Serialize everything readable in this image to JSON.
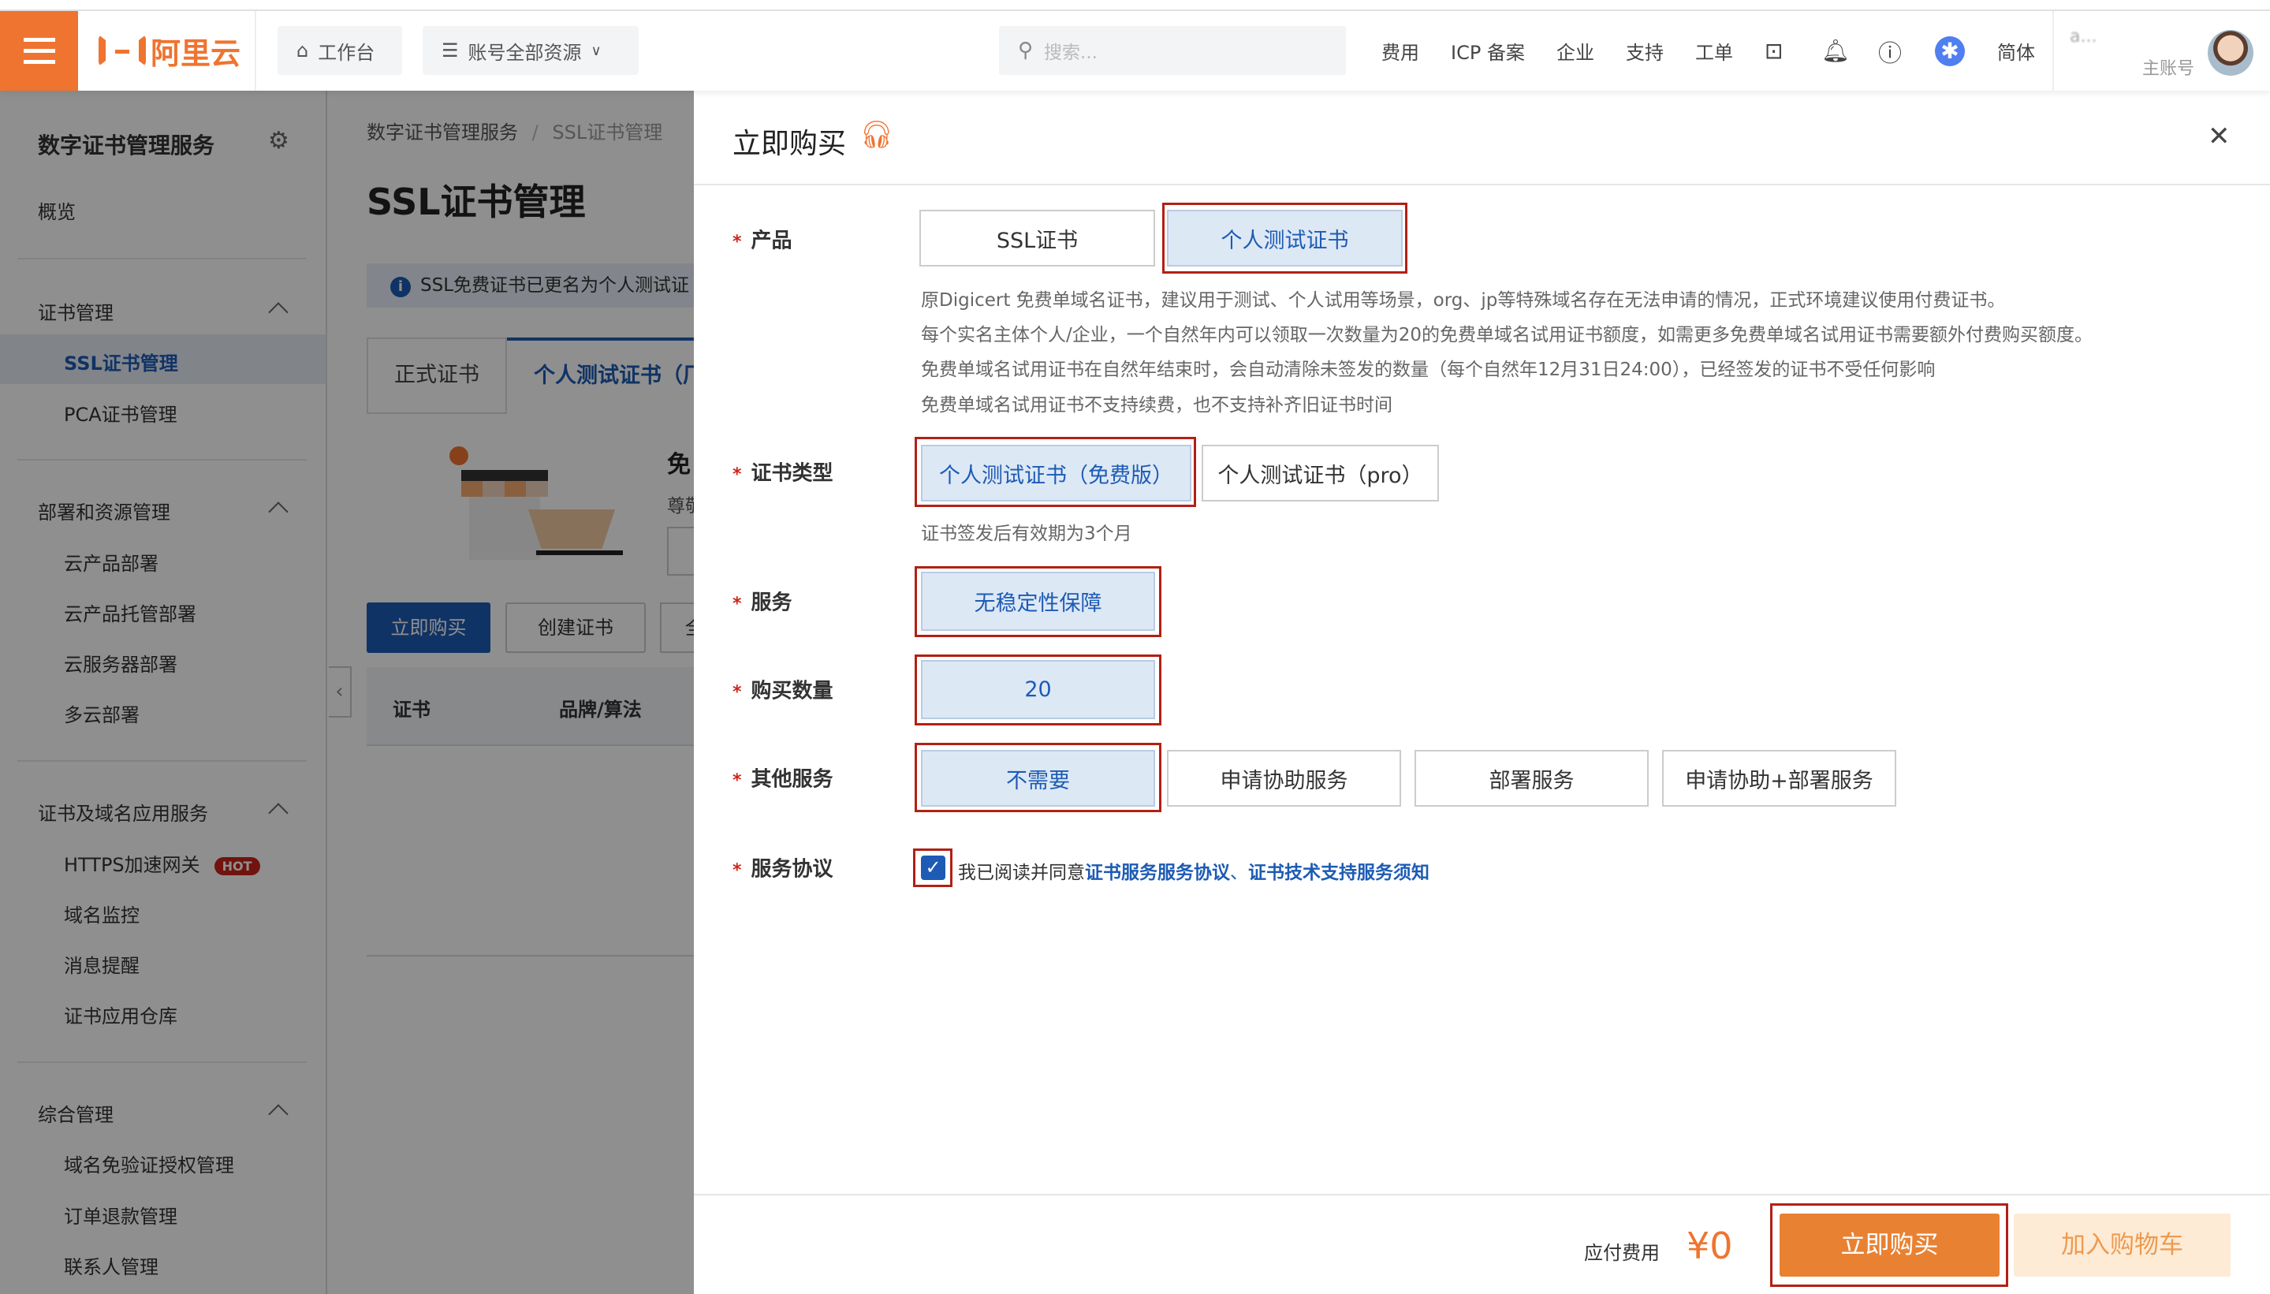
{
  "header": {
    "logo_text": "阿里云",
    "workbench": "工作台",
    "resources": "账号全部资源",
    "search_placeholder": "搜索...",
    "nav": [
      "费用",
      "ICP 备案",
      "企业",
      "支持",
      "工单"
    ],
    "lang": "简体",
    "username": "a...",
    "account_type": "主账号"
  },
  "sidebar": {
    "title": "数字证书管理服务",
    "overview": "概览",
    "groups": [
      {
        "label": "证书管理",
        "items": [
          "SSL证书管理",
          "PCA证书管理"
        ]
      },
      {
        "label": "部署和资源管理",
        "items": [
          "云产品部署",
          "云产品托管部署",
          "云服务器部署",
          "多云部署"
        ]
      },
      {
        "label": "证书及域名应用服务",
        "items": [
          "HTTPS加速网关",
          "域名监控",
          "消息提醒",
          "证书应用仓库"
        ]
      },
      {
        "label": "综合管理",
        "items": [
          "域名免验证授权管理",
          "订单退款管理",
          "联系人管理"
        ]
      }
    ],
    "hot_badge": "HOT",
    "active_item": "SSL证书管理"
  },
  "main": {
    "breadcrumb": [
      "数字证书管理服务",
      "/",
      "SSL证书管理"
    ],
    "title": "SSL证书管理",
    "notice": "SSL免费证书已更名为个人测试证",
    "tabs": [
      "正式证书",
      "个人测试证书（厂"
    ],
    "promo_title": "免",
    "promo_sub": "尊敬",
    "buy_button": "立即购买",
    "create_button": "创建证书",
    "third_button": "全",
    "table_headers": [
      "证书",
      "品牌/算法"
    ]
  },
  "drawer": {
    "title": "立即购买",
    "product": {
      "label": "产品",
      "options": [
        "SSL证书",
        "个人测试证书"
      ],
      "selected": "个人测试证书"
    },
    "description": [
      "原Digicert 免费单域名证书，建议用于测试、个人试用等场景，org、jp等特殊域名存在无法申请的情况，正式环境建议使用付费证书。",
      "每个实名主体个人/企业，一个自然年内可以领取一次数量为20的免费单域名试用证书额度，如需更多免费单域名试用证书需要额外付费购买额度。",
      "免费单域名试用证书在自然年结束时，会自动清除未签发的数量（每个自然年12月31日24:00），已经签发的证书不受任何影响",
      "免费单域名试用证书不支持续费，也不支持补齐旧证书时间"
    ],
    "cert_type": {
      "label": "证书类型",
      "options": [
        "个人测试证书（免费版）",
        "个人测试证书（pro）"
      ],
      "selected": "个人测试证书（免费版）",
      "hint": "证书签发后有效期为3个月"
    },
    "service": {
      "label": "服务",
      "options": [
        "无稳定性保障"
      ],
      "selected": "无稳定性保障"
    },
    "quantity": {
      "label": "购买数量",
      "value": "20"
    },
    "other_services": {
      "label": "其他服务",
      "options": [
        "不需要",
        "申请协助服务",
        "部署服务",
        "申请协助+部署服务"
      ],
      "selected": "不需要"
    },
    "agreement": {
      "label": "服务协议",
      "checked": true,
      "text": "我已阅读并同意",
      "link1": "证书服务服务协议",
      "sep": "、",
      "link2": "证书技术支持服务须知"
    },
    "footer": {
      "fee_label": "应付费用",
      "fee": "¥0",
      "buy": "立即购买",
      "cart": "加入购物车"
    }
  },
  "colors": {
    "brand": "#ef7430",
    "primary_blue": "#1d5bb4",
    "selected_bg": "#dde8f5",
    "highlight_red": "#b22014",
    "required": "#d0261b"
  }
}
